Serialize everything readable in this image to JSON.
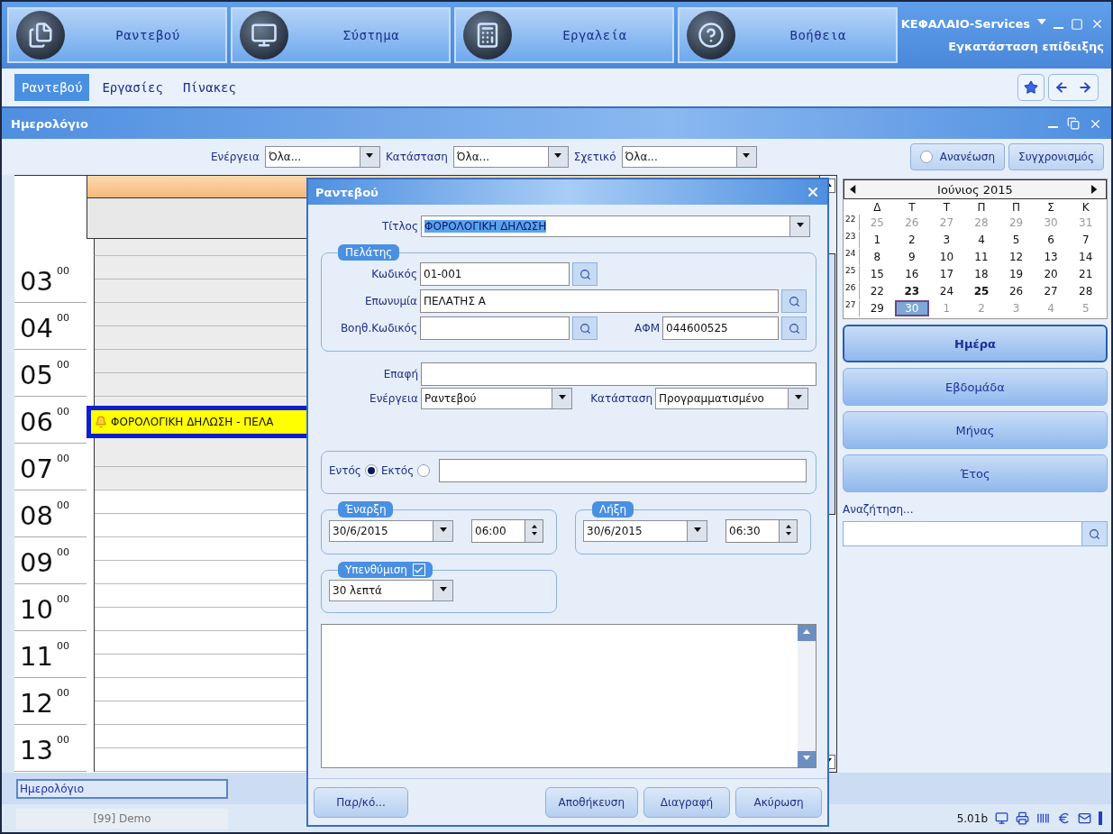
{
  "top_menu": [
    {
      "label": "Ραντεβού",
      "kind": "documents"
    },
    {
      "label": "Σύστημα",
      "kind": "monitor"
    },
    {
      "label": "Εργαλεία",
      "kind": "calculator"
    },
    {
      "label": "Βοήθεια",
      "kind": "help"
    }
  ],
  "app": {
    "company": "ΚΕΦΑΛΑΙΟ-Services",
    "installation": "Εγκατάσταση επίδειξης"
  },
  "ribbon_tabs": [
    {
      "label": "Ραντεβού",
      "selected": true
    },
    {
      "label": "Εργασίες",
      "selected": false
    },
    {
      "label": "Πίνακες",
      "selected": false
    }
  ],
  "panel": {
    "title": "Ημερολόγιο"
  },
  "filters": [
    {
      "label": "Ενέργεια",
      "value": "Όλα..."
    },
    {
      "label": "Κατάσταση",
      "value": "Όλα..."
    },
    {
      "label": "Σχετικό",
      "value": "Όλα..."
    }
  ],
  "actions": {
    "refresh": "Ανανέωση",
    "sync": "Συγχρονισμός"
  },
  "schedule": {
    "hours": [
      {
        "hour": "03",
        "minutes": "00",
        "off_hours": true
      },
      {
        "hour": "04",
        "minutes": "00",
        "off_hours": true
      },
      {
        "hour": "05",
        "minutes": "00",
        "off_hours": true
      },
      {
        "hour": "06",
        "minutes": "00",
        "off_hours": true,
        "event": "ΦΟΡΟΛΟΓΙΚΗ ΔΗΛΩΣΗ - ΠΕΛΑ"
      },
      {
        "hour": "07",
        "minutes": "00",
        "off_hours": true
      },
      {
        "hour": "08",
        "minutes": "00",
        "off_hours": false
      },
      {
        "hour": "09",
        "minutes": "00",
        "off_hours": false
      },
      {
        "hour": "10",
        "minutes": "00",
        "off_hours": false
      },
      {
        "hour": "11",
        "minutes": "00",
        "off_hours": false
      },
      {
        "hour": "12",
        "minutes": "00",
        "off_hours": false
      },
      {
        "hour": "13",
        "minutes": "00",
        "off_hours": false
      }
    ]
  },
  "mini_calendar": {
    "month": "Ιούνιος 2015",
    "weekdays": [
      "Δ",
      "Τ",
      "Τ",
      "Π",
      "Π",
      "Σ",
      "Κ"
    ],
    "weeks": [
      {
        "week": "22",
        "days": [
          {
            "day": "25",
            "dim": true,
            "bold": false,
            "selected": false
          },
          {
            "day": "26",
            "dim": true,
            "bold": false,
            "selected": false
          },
          {
            "day": "27",
            "dim": true,
            "bold": false,
            "selected": false
          },
          {
            "day": "28",
            "dim": true,
            "bold": false,
            "selected": false
          },
          {
            "day": "29",
            "dim": true,
            "bold": false,
            "selected": false
          },
          {
            "day": "30",
            "dim": true,
            "bold": false,
            "selected": false
          },
          {
            "day": "31",
            "dim": true,
            "bold": false,
            "selected": false
          }
        ]
      },
      {
        "week": "23",
        "days": [
          {
            "day": "1",
            "dim": false,
            "bold": false,
            "selected": false
          },
          {
            "day": "2",
            "dim": false,
            "bold": false,
            "selected": false
          },
          {
            "day": "3",
            "dim": false,
            "bold": false,
            "selected": false
          },
          {
            "day": "4",
            "dim": false,
            "bold": false,
            "selected": false
          },
          {
            "day": "5",
            "dim": false,
            "bold": false,
            "selected": false
          },
          {
            "day": "6",
            "dim": false,
            "bold": false,
            "selected": false
          },
          {
            "day": "7",
            "dim": false,
            "bold": false,
            "selected": false
          }
        ]
      },
      {
        "week": "24",
        "days": [
          {
            "day": "8",
            "dim": false,
            "bold": false,
            "selected": false
          },
          {
            "day": "9",
            "dim": false,
            "bold": false,
            "selected": false
          },
          {
            "day": "10",
            "dim": false,
            "bold": false,
            "selected": false
          },
          {
            "day": "11",
            "dim": false,
            "bold": false,
            "selected": false
          },
          {
            "day": "12",
            "dim": false,
            "bold": false,
            "selected": false
          },
          {
            "day": "13",
            "dim": false,
            "bold": false,
            "selected": false
          },
          {
            "day": "14",
            "dim": false,
            "bold": false,
            "selected": false
          }
        ]
      },
      {
        "week": "25",
        "days": [
          {
            "day": "15",
            "dim": false,
            "bold": false,
            "selected": false
          },
          {
            "day": "16",
            "dim": false,
            "bold": false,
            "selected": false
          },
          {
            "day": "17",
            "dim": false,
            "bold": false,
            "selected": false
          },
          {
            "day": "18",
            "dim": false,
            "bold": false,
            "selected": false
          },
          {
            "day": "19",
            "dim": false,
            "bold": false,
            "selected": false
          },
          {
            "day": "20",
            "dim": false,
            "bold": false,
            "selected": false
          },
          {
            "day": "21",
            "dim": false,
            "bold": false,
            "selected": false
          }
        ]
      },
      {
        "week": "26",
        "days": [
          {
            "day": "22",
            "dim": false,
            "bold": false,
            "selected": false
          },
          {
            "day": "23",
            "dim": false,
            "bold": true,
            "selected": false
          },
          {
            "day": "24",
            "dim": false,
            "bold": false,
            "selected": false
          },
          {
            "day": "25",
            "dim": false,
            "bold": true,
            "selected": false
          },
          {
            "day": "26",
            "dim": false,
            "bold": false,
            "selected": false
          },
          {
            "day": "27",
            "dim": false,
            "bold": false,
            "selected": false
          },
          {
            "day": "28",
            "dim": false,
            "bold": false,
            "selected": false
          }
        ]
      },
      {
        "week": "27",
        "days": [
          {
            "day": "29",
            "dim": false,
            "bold": false,
            "selected": false
          },
          {
            "day": "30",
            "dim": false,
            "bold": false,
            "selected": true
          },
          {
            "day": "1",
            "dim": true,
            "bold": false,
            "selected": false
          },
          {
            "day": "2",
            "dim": true,
            "bold": false,
            "selected": false
          },
          {
            "day": "3",
            "dim": true,
            "bold": false,
            "selected": false
          },
          {
            "day": "4",
            "dim": true,
            "bold": false,
            "selected": false
          },
          {
            "day": "5",
            "dim": true,
            "bold": false,
            "selected": false
          }
        ]
      }
    ]
  },
  "view_buttons": [
    {
      "label": "Ημέρα",
      "selected": true
    },
    {
      "label": "Εβδομάδα",
      "selected": false
    },
    {
      "label": "Μήνας",
      "selected": false
    },
    {
      "label": "Έτος",
      "selected": false
    }
  ],
  "search": {
    "label": "Αναζήτηση..."
  },
  "status": {
    "field": "Ημερολόγιο",
    "user": "[99] Demo",
    "version": "5.01b"
  },
  "dialog": {
    "title": "Ραντεβού",
    "subject": {
      "label": "Τίτλος",
      "value": "ΦΟΡΟΛΟΓΙΚΗ ΔΗΛΩΣΗ"
    },
    "customer": {
      "legend": "Πελάτης",
      "code_label": "Κωδικός",
      "code": "01-001",
      "name_label": "Επωνυμία",
      "name": "ΠΕΛΑΤΗΣ Α",
      "alt_code_label": "Βοηθ.Κωδικός",
      "tax_label": "ΑΦΜ",
      "tax_id": "044600525"
    },
    "contact": {
      "label": "Επαφή"
    },
    "action": {
      "label": "Ενέργεια",
      "value": "Ραντεβού"
    },
    "state": {
      "label": "Κατάσταση",
      "value": "Προγραμματισμένο"
    },
    "location": {
      "options": [
        {
          "label": "Εντός",
          "selected": true
        },
        {
          "label": "Εκτός",
          "selected": false
        }
      ]
    },
    "start": {
      "legend": "Έναρξη",
      "date": "30/6/2015",
      "time": "06:00"
    },
    "end": {
      "legend": "Λήξη",
      "date": "30/6/2015",
      "time": "06:30"
    },
    "reminder": {
      "legend": "Υπενθύμιση",
      "checked": true,
      "value": "30 λεπτά"
    },
    "buttons": [
      "Παρ/κό...",
      "Αποθήκευση",
      "Διαγραφή",
      "Ακύρωση"
    ]
  }
}
